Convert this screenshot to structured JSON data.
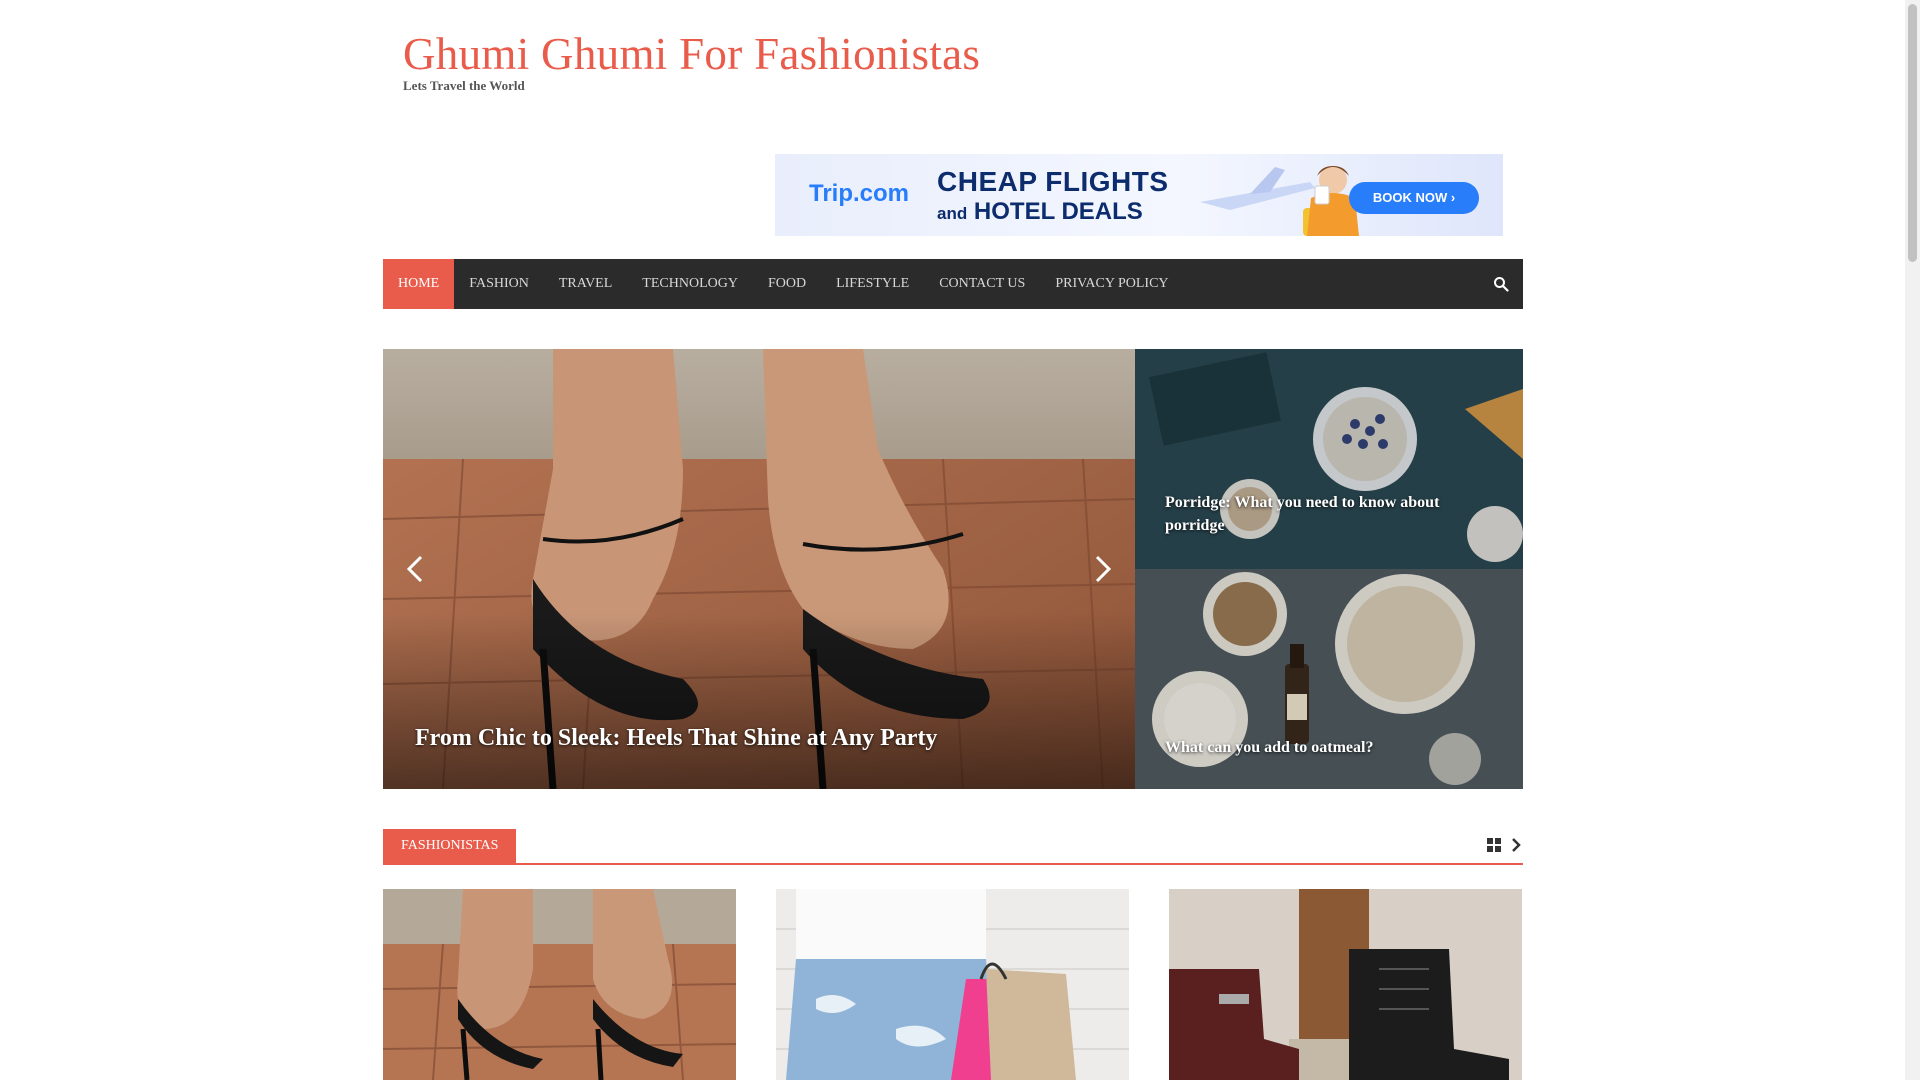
{
  "site": {
    "title": "Ghumi Ghumi For Fashionistas",
    "description": "Lets Travel the World"
  },
  "ad": {
    "brand": "Trip.com",
    "line1": "CHEAP FLIGHTS",
    "line2_prefix": "and",
    "line2": "HOTEL DEALS",
    "cta": "BOOK NOW ›"
  },
  "nav": {
    "items": [
      {
        "label": "HOME",
        "active": true
      },
      {
        "label": "FASHION"
      },
      {
        "label": "TRAVEL"
      },
      {
        "label": "TECHNOLOGY"
      },
      {
        "label": "FOOD"
      },
      {
        "label": "LIFESTYLE"
      },
      {
        "label": "CONTACT US"
      },
      {
        "label": "PRIVACY POLICY"
      }
    ],
    "search_icon": "search-icon"
  },
  "slider": {
    "caption": "From Chic to Sleek: Heels That Shine at Any Party"
  },
  "side_posts": [
    {
      "title": "Porridge: What you need to know about porridge"
    },
    {
      "title": "What can you add to oatmeal?"
    }
  ],
  "section": {
    "label": "FASHIONISTAS"
  },
  "colors": {
    "accent": "#e95c4b",
    "nav_bg": "#2b2b2b"
  }
}
